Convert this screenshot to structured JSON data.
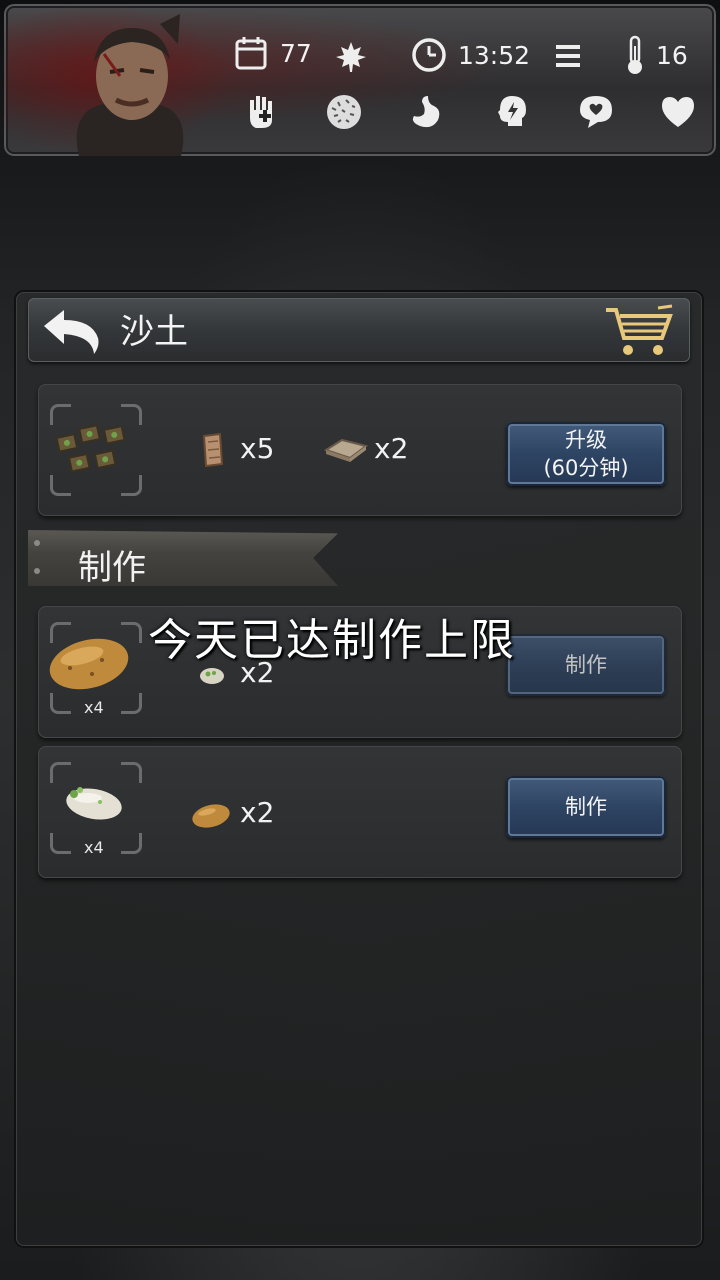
{
  "hud": {
    "days": "77",
    "time": "13:52",
    "temperature": "16",
    "icons": [
      "calendar-icon",
      "maple-leaf-icon",
      "clock-icon",
      "menu-icon",
      "thermometer-icon",
      "first-aid-glove-icon",
      "fatigue-icon",
      "stomach-icon",
      "mind-icon",
      "mood-icon",
      "heart-icon"
    ]
  },
  "panel": {
    "title": "沙土",
    "upgrade": {
      "requirements": [
        {
          "icon": "wood-plank-icon",
          "qty": "x5"
        },
        {
          "icon": "sandbag-icon",
          "qty": "x2"
        }
      ],
      "button_line1": "升级",
      "button_line2": "(60分钟)"
    },
    "section_title": "制作",
    "recipes": [
      {
        "output_icon": "potato-icon",
        "output_qty": "x4",
        "ingredient_icon": "seed-potato-icon",
        "ingredient_qty": "x2",
        "button": "制作"
      },
      {
        "output_icon": "sprouted-potato-icon",
        "output_qty": "x4",
        "ingredient_icon": "potato-icon",
        "ingredient_qty": "x2",
        "button": "制作"
      }
    ],
    "limit_message": "今天已达制作上限"
  }
}
